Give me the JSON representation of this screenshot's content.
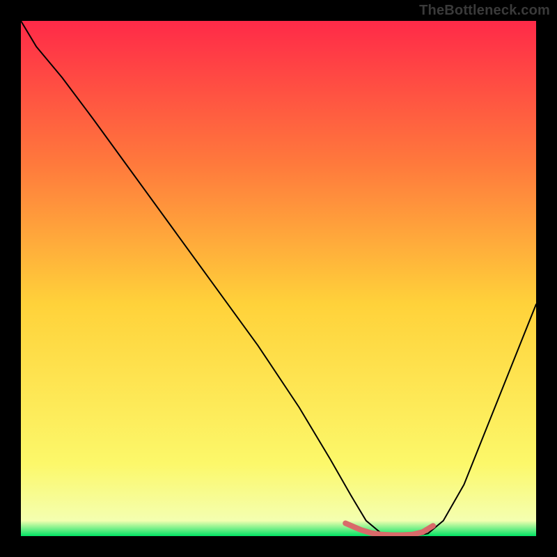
{
  "watermark": "TheBottleneck.com",
  "chart_data": {
    "type": "line",
    "title": "",
    "xlabel": "",
    "ylabel": "",
    "xlim": [
      0,
      100
    ],
    "ylim": [
      0,
      100
    ],
    "grid": false,
    "legend": false,
    "annotations": [],
    "background": {
      "gradient_top": "#ff2a48",
      "gradient_mid_upper": "#ff7a3c",
      "gradient_mid": "#ffd23a",
      "gradient_mid_lower": "#fcf86a",
      "gradient_bottom": "#00e264"
    },
    "series": [
      {
        "name": "curve",
        "color": "#000000",
        "x": [
          0,
          3,
          8,
          14,
          22,
          30,
          38,
          46,
          54,
          60,
          64,
          67,
          70,
          73,
          76,
          79,
          82,
          86,
          90,
          94,
          100
        ],
        "y": [
          100,
          95,
          89,
          81,
          70,
          59,
          48,
          37,
          25,
          15,
          8,
          3,
          0.5,
          0,
          0,
          0.5,
          3,
          10,
          20,
          30,
          45
        ]
      },
      {
        "name": "optimal-band",
        "color": "#d96a6a",
        "x": [
          63,
          66,
          68,
          70,
          72,
          74,
          76,
          78,
          80
        ],
        "y": [
          2.5,
          1.2,
          0.6,
          0.3,
          0.2,
          0.2,
          0.3,
          0.8,
          2.0
        ]
      }
    ]
  }
}
